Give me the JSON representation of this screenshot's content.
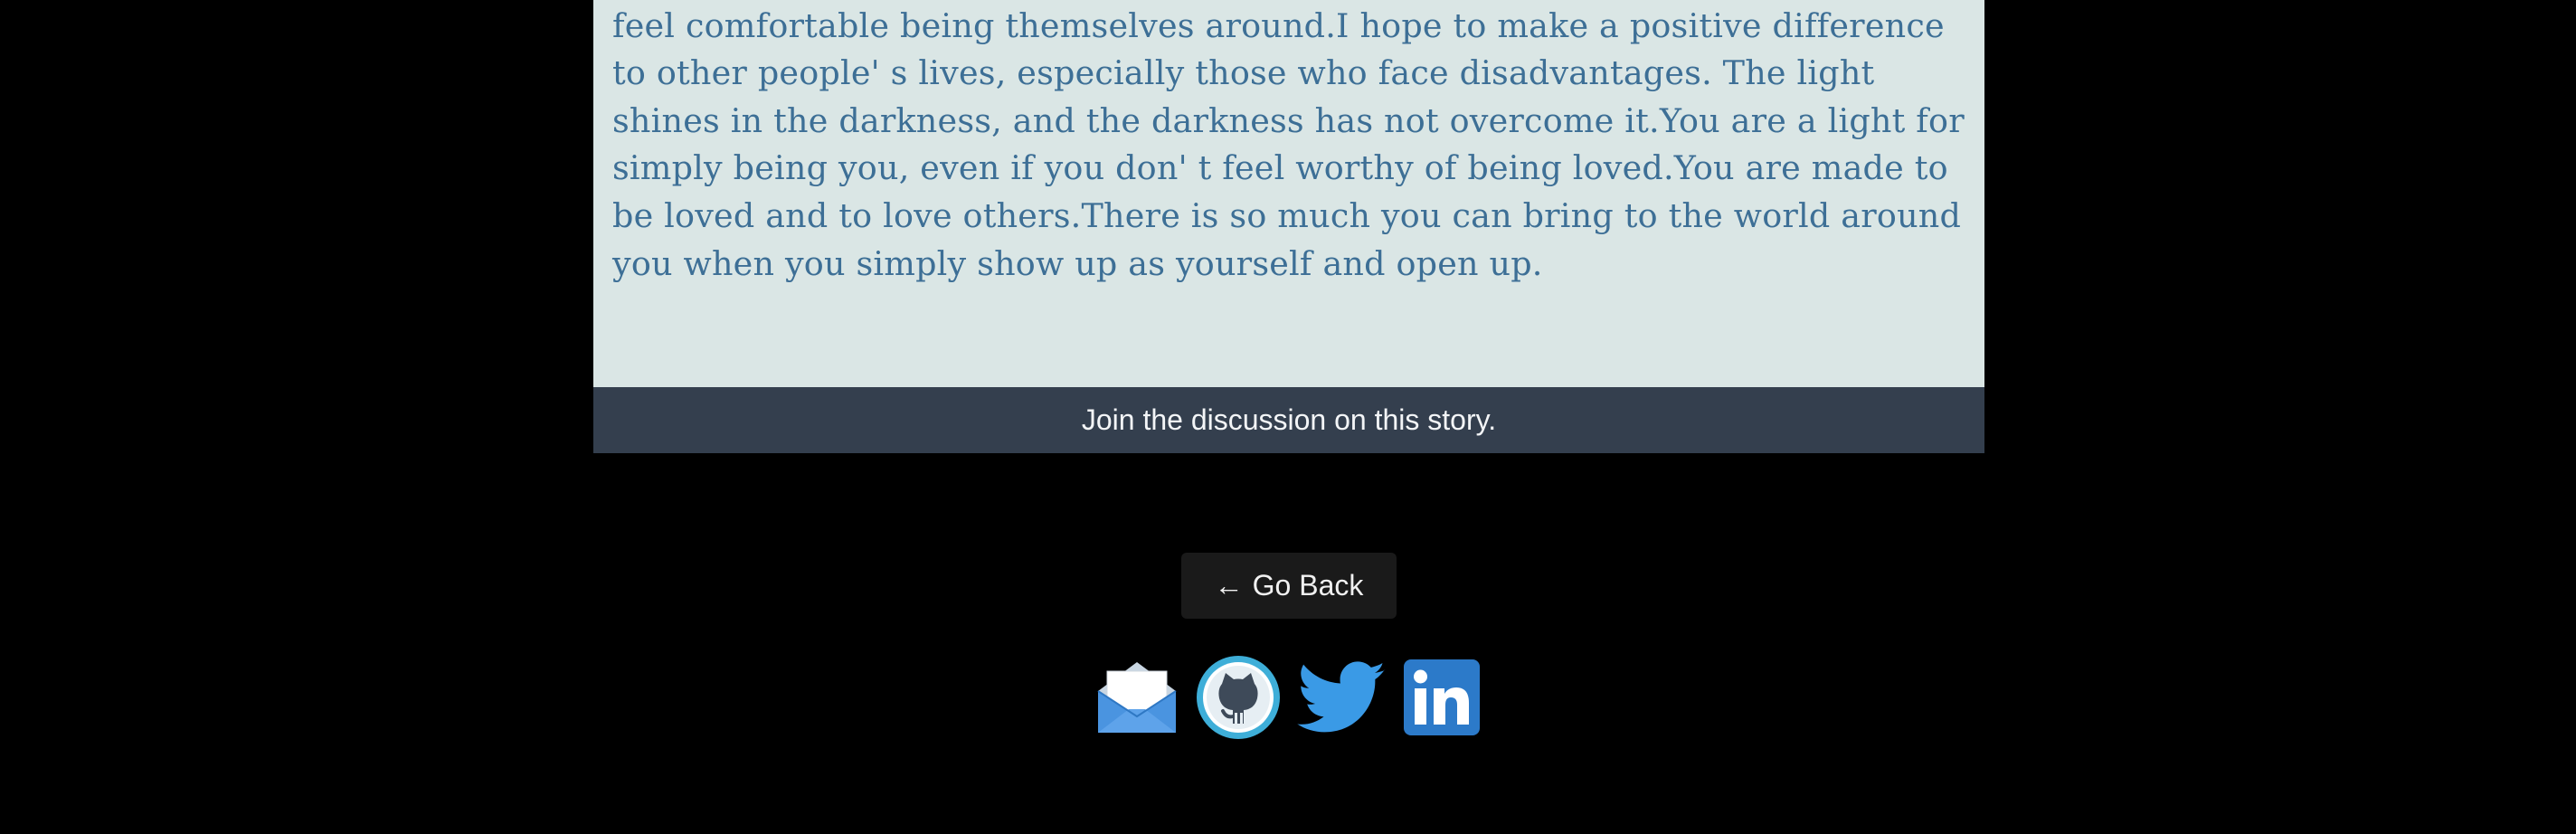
{
  "story": {
    "text": "someone everyone will remember as someone who is trustworthy, whom they feel comfortable being themselves around.I hope to make a positive difference to other people' s lives, especially those who face disadvantages. The light shines in the darkness, and the darkness has not overcome it.You are a light for simply being you, even if you don' t feel worthy of being loved.You are made to be loved and to love others.There is so much you can bring to the world around you when you simply show up as yourself and open up."
  },
  "discussion": {
    "label": "Join the discussion on this story."
  },
  "back_button": {
    "arrow": "←",
    "label": "Go Back"
  },
  "social": {
    "icons": [
      "envelope-icon",
      "github-icon",
      "twitter-icon",
      "linkedin-icon"
    ]
  },
  "colors": {
    "page_bg": "#000000",
    "card_bg": "#dae6e5",
    "story_text": "#3d6f96",
    "discussion_bg": "#343f4e",
    "button_bg": "#1a1a1a"
  }
}
